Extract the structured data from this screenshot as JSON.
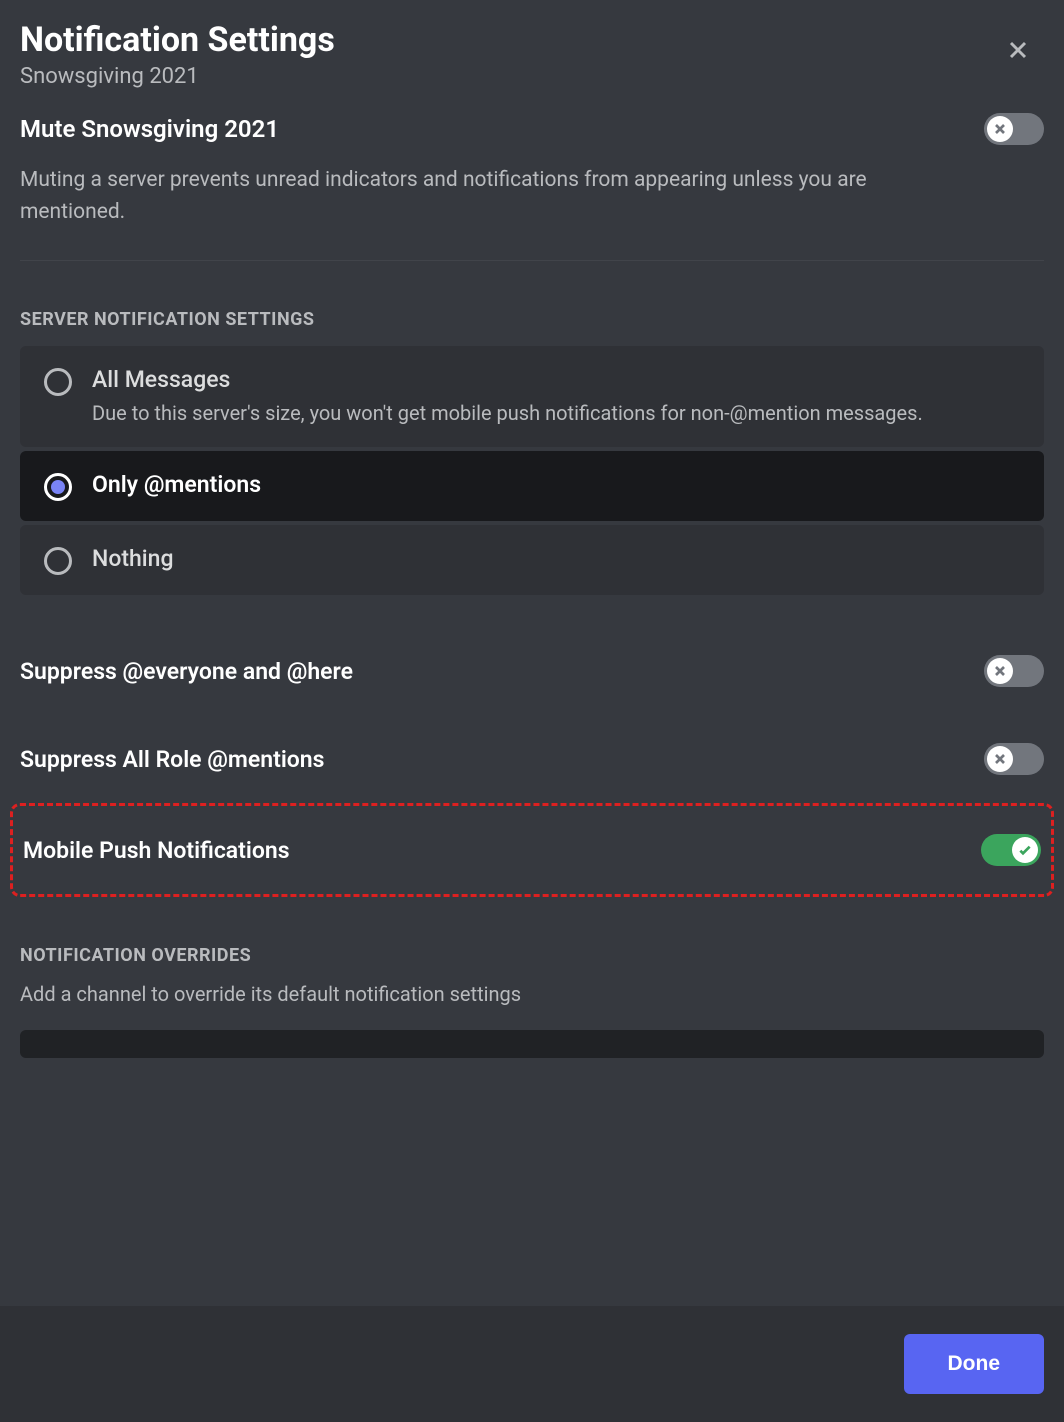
{
  "header": {
    "title": "Notification Settings",
    "subtitle": "Snowsgiving 2021"
  },
  "mute": {
    "label": "Mute Snowsgiving 2021",
    "description": "Muting a server prevents unread indicators and notifications from appearing unless you are mentioned.",
    "enabled": false
  },
  "server_settings": {
    "header": "SERVER NOTIFICATION SETTINGS",
    "options": [
      {
        "label": "All Messages",
        "description": "Due to this server's size, you won't get mobile push notifications for non-@mention messages.",
        "selected": false
      },
      {
        "label": "Only @mentions",
        "description": "",
        "selected": true
      },
      {
        "label": "Nothing",
        "description": "",
        "selected": false
      }
    ]
  },
  "switches": {
    "suppress_everyone": {
      "label": "Suppress @everyone and @here",
      "enabled": false
    },
    "suppress_roles": {
      "label": "Suppress All Role @mentions",
      "enabled": false
    },
    "mobile_push": {
      "label": "Mobile Push Notifications",
      "enabled": true
    }
  },
  "overrides": {
    "header": "NOTIFICATION OVERRIDES",
    "description": "Add a channel to override its default notification settings"
  },
  "footer": {
    "done_label": "Done"
  }
}
